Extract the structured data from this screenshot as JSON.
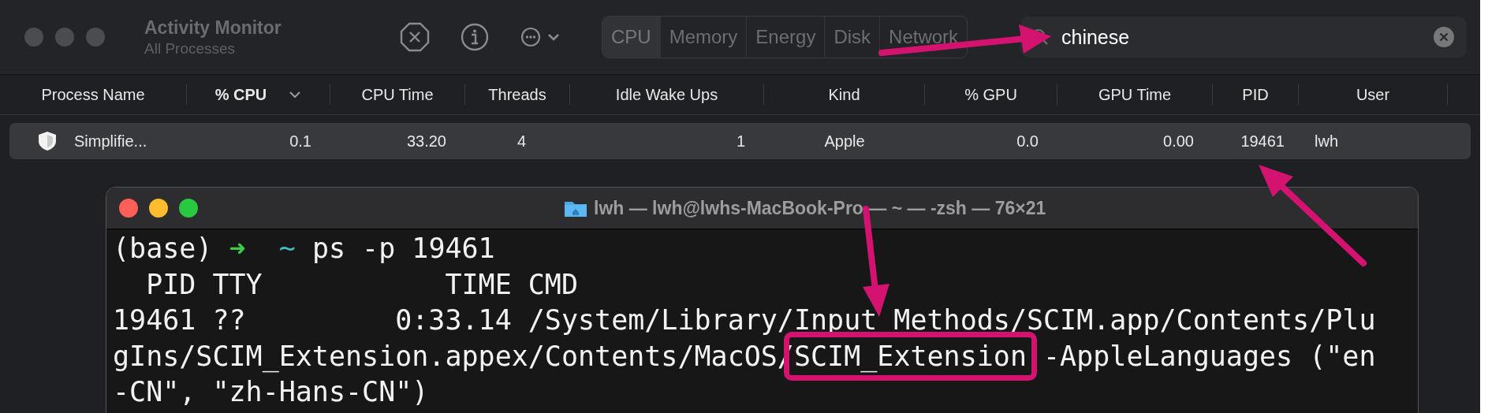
{
  "window": {
    "title": "Activity Monitor",
    "subtitle": "All Processes"
  },
  "toolbar": {
    "buttons": [
      {
        "kind": "stop"
      },
      {
        "kind": "info"
      },
      {
        "kind": "more"
      }
    ]
  },
  "tabs": [
    {
      "label": "CPU",
      "selected": true
    },
    {
      "label": "Memory",
      "selected": false
    },
    {
      "label": "Energy",
      "selected": false
    },
    {
      "label": "Disk",
      "selected": false
    },
    {
      "label": "Network",
      "selected": false
    }
  ],
  "search": {
    "value": "chinese"
  },
  "table": {
    "columns": [
      {
        "label": "Process Name",
        "sorted": false
      },
      {
        "label": "% CPU",
        "sorted": true
      },
      {
        "label": "CPU Time",
        "sorted": false
      },
      {
        "label": "Threads",
        "sorted": false
      },
      {
        "label": "Idle Wake Ups",
        "sorted": false
      },
      {
        "label": "Kind",
        "sorted": false
      },
      {
        "label": "% GPU",
        "sorted": false
      },
      {
        "label": "GPU Time",
        "sorted": false
      },
      {
        "label": "PID",
        "sorted": false
      },
      {
        "label": "User",
        "sorted": false
      }
    ],
    "rows": [
      {
        "selected": true,
        "cells": [
          "Simplifie...",
          "0.1",
          "33.20",
          "4",
          "1",
          "Apple",
          "0.0",
          "0.00",
          "19461",
          "lwh"
        ]
      }
    ]
  },
  "terminal": {
    "title": "lwh — lwh@lwhs-MacBook-Pro — ~ — -zsh — 76×21",
    "lines": [
      {
        "segments": [
          {
            "text": "(base) ",
            "kind": "plain"
          },
          {
            "text": "➜",
            "kind": "arrow"
          },
          {
            "text": "~",
            "kind": "dir"
          },
          {
            "text": " ps -p 19461",
            "kind": "plain"
          }
        ]
      },
      {
        "segments": [
          {
            "text": "  PID TTY           TIME CMD",
            "kind": "plain"
          }
        ]
      },
      {
        "segments": [
          {
            "text": "19461 ??         0:33.14 /System/Library/Input Methods/SCIM.app/Contents/Plu",
            "kind": "plain"
          }
        ]
      },
      {
        "segments": [
          {
            "text": "gIns/SCIM_Extension.appex/Contents/MacOS/",
            "kind": "plain"
          },
          {
            "text": "SCIM_Extension",
            "kind": "boxed"
          },
          {
            "text": " -AppleLanguages (\"en",
            "kind": "plain"
          }
        ]
      },
      {
        "segments": [
          {
            "text": "-CN\", \"zh-Hans-CN\")",
            "kind": "plain"
          }
        ]
      }
    ]
  }
}
